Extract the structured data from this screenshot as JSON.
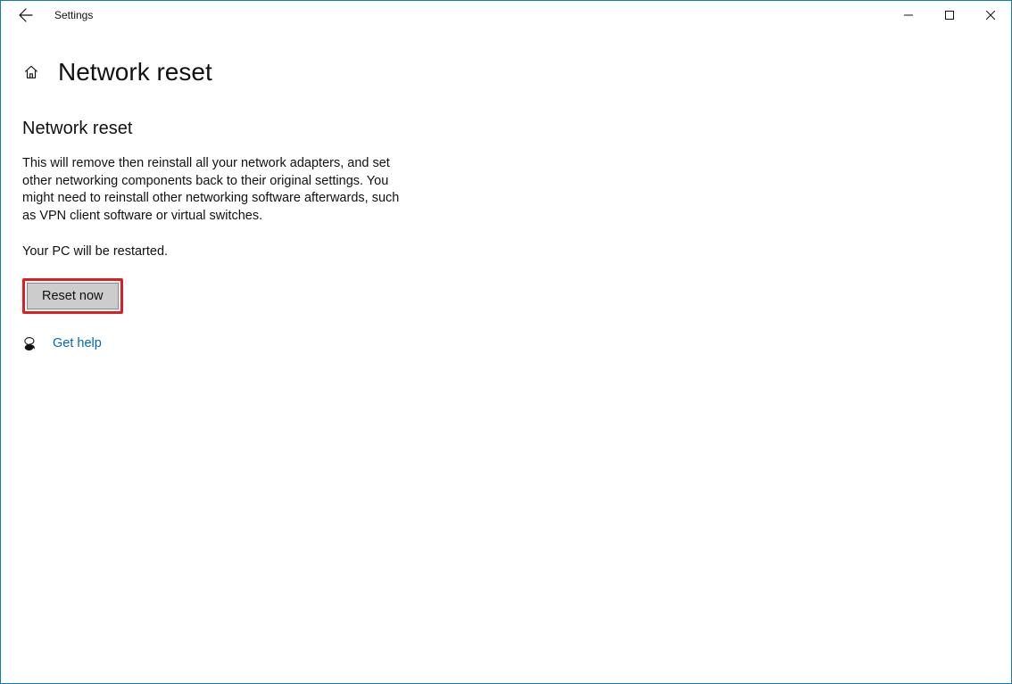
{
  "window": {
    "title": "Settings"
  },
  "page": {
    "title": "Network reset",
    "sectionTitle": "Network reset",
    "description": "This will remove then reinstall all your network adapters, and set other networking components back to their original settings. You might need to reinstall other networking software afterwards, such as VPN client software or virtual switches.",
    "restartNotice": "Your PC will be restarted.",
    "resetButtonLabel": "Reset now",
    "helpLinkLabel": "Get help"
  }
}
